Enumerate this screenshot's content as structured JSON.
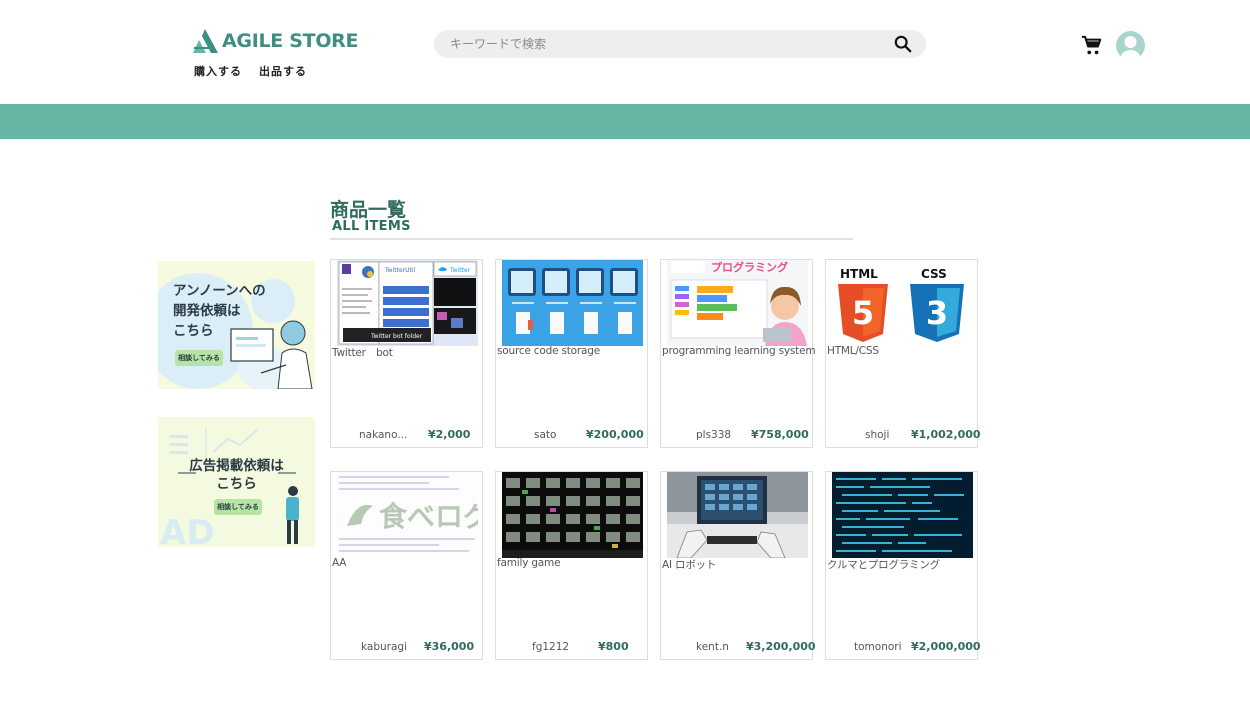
{
  "header": {
    "logo_text": "AGILE STORE",
    "nav": [
      "購入する",
      "出品する"
    ],
    "search_placeholder": "キーワードで検索",
    "accent_color": "#67b5a5"
  },
  "section": {
    "title_jp": "商品一覧",
    "title_en": "ALL ITEMS"
  },
  "banners": [
    {
      "lines": [
        "アンノーンへの",
        "開発依頼は",
        "こちら"
      ],
      "button": "相談してみる"
    },
    {
      "lines": [
        "広告掲載依頼は",
        "こちら"
      ],
      "button": "相談してみる",
      "watermark": "AD"
    }
  ],
  "thumb_texts": {
    "twitter_a": "TwitterUtil",
    "twitter_b": "Twitter",
    "twitter_c": "Twitter bot folder",
    "programming": "プログラミング",
    "html": "HTML",
    "css": "CSS",
    "tabelog": "食べログ"
  },
  "items": [
    {
      "title": "Twitter　bot",
      "seller": "nakano...",
      "price": "¥2,000",
      "icon": "twitter-bot-thumbnail"
    },
    {
      "title": "source code storage",
      "seller": "sato",
      "price": "¥200,000",
      "icon": "source-code-thumbnail"
    },
    {
      "title": "programming learning system",
      "seller": "pls338",
      "price": "¥758,000",
      "icon": "programming-thumbnail"
    },
    {
      "title": "HTML/CSS",
      "seller": "shoji",
      "price": "¥1,002,000",
      "icon": "html-css-thumbnail"
    },
    {
      "title": "AA",
      "seller": "kaburagi",
      "price": "¥36,000",
      "icon": "tabelog-thumbnail"
    },
    {
      "title": "family game",
      "seller": "fg1212",
      "price": "¥800",
      "icon": "retro-game-thumbnail"
    },
    {
      "title": "AI ロボット",
      "seller": "kent.n",
      "price": "¥3,200,000",
      "icon": "robot-thumbnail"
    },
    {
      "title": "クルマとプログラミング",
      "seller": "tomonori",
      "price": "¥2,000,000",
      "icon": "code-screen-thumbnail"
    }
  ]
}
